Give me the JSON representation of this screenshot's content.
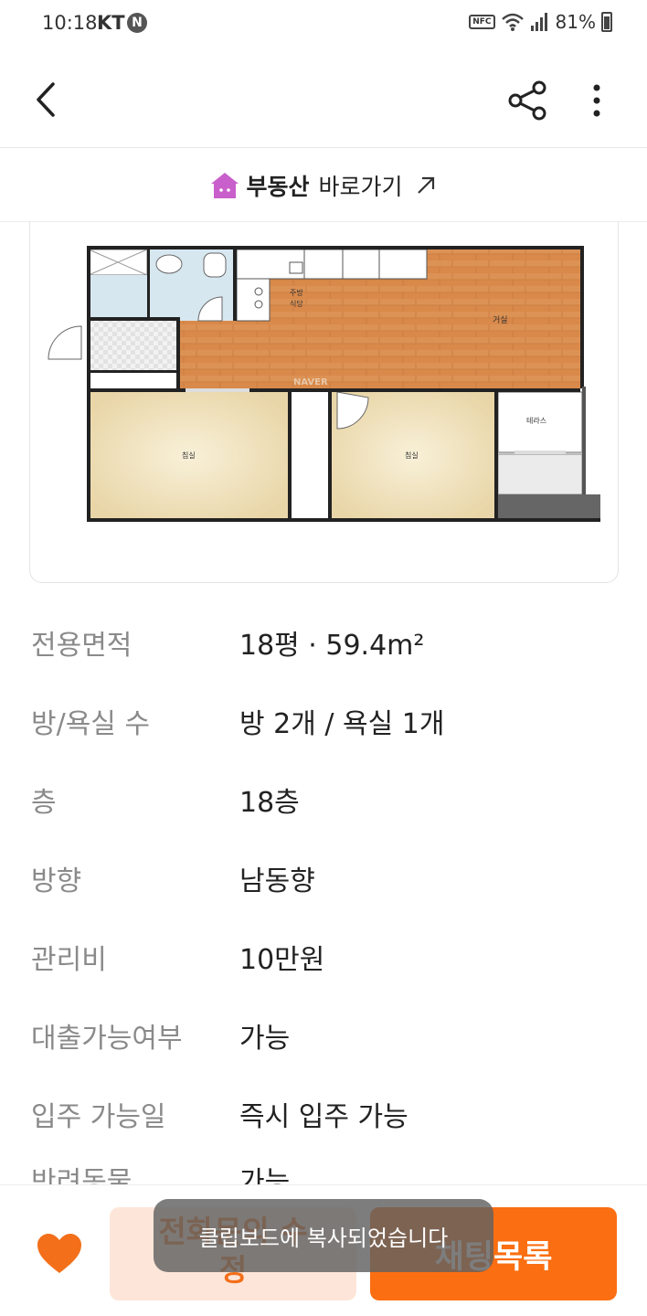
{
  "status_bar": {
    "time": "10:18",
    "carrier": "KT",
    "notification_badge": "N",
    "nfc": "NFC",
    "battery": "81%"
  },
  "app_bar": {
    "back_icon": "back-chevron-icon",
    "share_icon": "share-icon",
    "more_icon": "more-vertical-icon"
  },
  "link_bar": {
    "icon": "house-icon",
    "brand": "부동산",
    "text": "바로가기",
    "arrow_icon": "external-arrow-icon"
  },
  "floor_plan": {
    "labels": {
      "kitchen": [
        "주방",
        "식당"
      ],
      "living": "거실",
      "terrace": "테라스",
      "bedroom_left": "침실",
      "bedroom_right": "침실",
      "watermark": "NAVER"
    }
  },
  "details": [
    {
      "label": "전용면적",
      "value": "18평 · 59.4m²"
    },
    {
      "label": "방/욕실 수",
      "value": "방 2개 / 욕실 1개"
    },
    {
      "label": "층",
      "value": "18층"
    },
    {
      "label": "방향",
      "value": "남동향"
    },
    {
      "label": "관리비",
      "value": "10만원"
    },
    {
      "label": "대출가능여부",
      "value": "가능"
    },
    {
      "label": "입주 가능일",
      "value": "즉시 입주 가능"
    },
    {
      "label": "반려동물",
      "value": "가능"
    }
  ],
  "bottom_bar": {
    "favorite_icon": "heart-icon",
    "edit_label_line1": "전화문의 수",
    "edit_label_line2": "정",
    "chat_label": "채팅목록"
  },
  "toast": "클립보드에 복사되었습니다",
  "colors": {
    "accent": "#fb6e11",
    "accent_light": "#fde6d9",
    "house_icon": "#c95fcb"
  }
}
